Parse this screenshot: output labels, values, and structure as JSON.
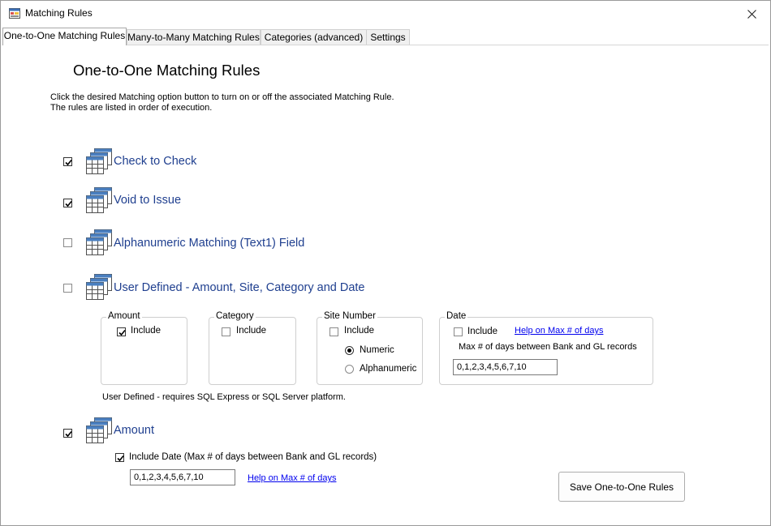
{
  "window": {
    "title": "Matching Rules"
  },
  "tabs": [
    {
      "label": "One-to-One Matching Rules"
    },
    {
      "label": "Many-to-Many Matching Rules"
    },
    {
      "label": "Categories (advanced)"
    },
    {
      "label": "Settings"
    }
  ],
  "main": {
    "heading": "One-to-One Matching Rules",
    "description": "Click the desired Matching option button to turn on or off the associated Matching Rule.\nThe rules are listed in order of execution."
  },
  "rules": [
    {
      "label": "Check to Check",
      "checked": true,
      "icon": "table-stack-icon"
    },
    {
      "label": "Void to Issue",
      "checked": true,
      "icon": "table-stack-icon"
    },
    {
      "label": "Alphanumeric Matching (Text1) Field",
      "checked": false,
      "icon": "table-stack-icon"
    },
    {
      "label": "User Defined - Amount, Site, Category and Date",
      "checked": false,
      "icon": "table-stack-icon"
    },
    {
      "label": "Amount",
      "checked": true,
      "icon": "table-stack-icon"
    }
  ],
  "user_defined": {
    "amount": {
      "title": "Amount",
      "include_label": "Include",
      "include_checked": true
    },
    "category": {
      "title": "Category",
      "include_label": "Include",
      "include_checked": false
    },
    "site": {
      "title": "Site Number",
      "include_label": "Include",
      "include_checked": false,
      "options": [
        {
          "label": "Numeric",
          "selected": true
        },
        {
          "label": "Alphanumeric",
          "selected": false
        }
      ]
    },
    "date": {
      "title": "Date",
      "include_label": "Include",
      "include_checked": false,
      "help_link": "Help on Max # of days",
      "max_days_label": "Max # of days between Bank and GL records",
      "max_days_value": "0,1,2,3,4,5,6,7,10"
    },
    "note": "User Defined - requires SQL Express or SQL Server platform."
  },
  "amount_rule": {
    "include_date_label": "Include Date (Max # of days between Bank and GL records)",
    "include_date_checked": true,
    "max_days_value": "0,1,2,3,4,5,6,7,10",
    "help_link": "Help on Max # of days"
  },
  "save_button": "Save One-to-One Rules",
  "colors": {
    "rule_label": "#1f3f8f",
    "link": "#0000ee",
    "icon_blue": "#4a7fc0"
  }
}
